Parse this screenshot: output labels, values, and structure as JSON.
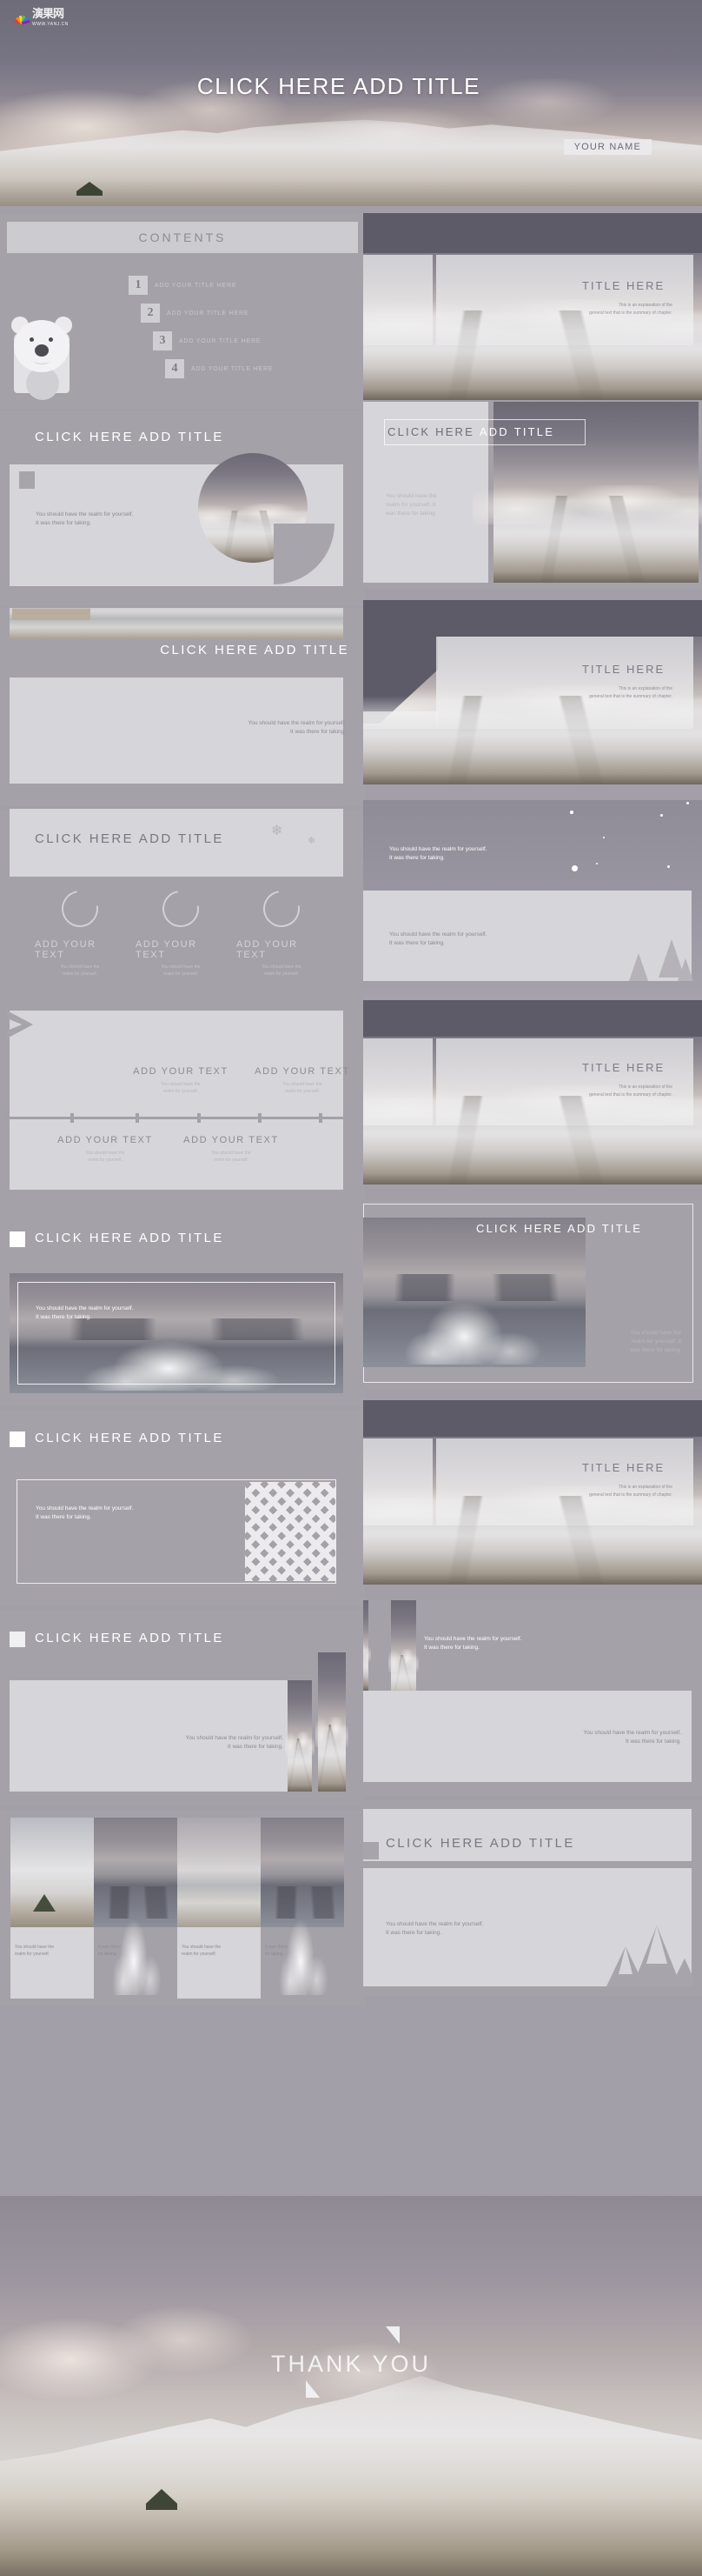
{
  "logo": {
    "name_zh": "演果网",
    "url": "WWW.YANJ.CN",
    "alt": "yanj-logo"
  },
  "cover": {
    "title": "CLICK HERE ADD TITLE",
    "name_box": "YOUR NAME"
  },
  "contents": {
    "heading": "CONTENTS",
    "items": [
      {
        "num": "1",
        "label": "ADD YOUR TITLE HERE"
      },
      {
        "num": "2",
        "label": "ADD YOUR TITLE HERE"
      },
      {
        "num": "3",
        "label": "ADD YOUR TITLE HERE"
      },
      {
        "num": "4",
        "label": "ADD YOUR TITLE HERE"
      }
    ]
  },
  "common": {
    "title": "CLICK HERE ADD TITLE",
    "chapter_title": "TITLE HERE",
    "chapter_sub_line1": "This is an explanation of the",
    "chapter_sub_line2": "general text that is the summary of chapter.",
    "body_line1": "You should have the realm for yourself.",
    "body_line2": "It was there for taking.",
    "body_short_1": "You should have the",
    "body_short_2": "realm for yourself. It",
    "body_short_3": "was there for taking.",
    "add_your_text": "ADD YOUR TEXT",
    "card_line1": "You should have the",
    "card_line2": "realm for yourself."
  },
  "slides": {
    "s03_circles": {
      "title": "CLICK HERE ADD TITLE",
      "cards": [
        {
          "heading": "ADD YOUR TEXT",
          "line1": "You should have the",
          "line2": "realm for yourself."
        },
        {
          "heading": "ADD YOUR TEXT",
          "line1": "You should have the",
          "line2": "realm for yourself."
        },
        {
          "heading": "ADD YOUR TEXT",
          "line1": "You should have the",
          "line2": "realm for yourself."
        }
      ]
    },
    "s04_timeline": {
      "top": [
        {
          "heading": "ADD YOUR TEXT",
          "line1": "You should have the",
          "line2": "realm for yourself."
        },
        {
          "heading": "ADD YOUR TEXT",
          "line1": "You should have the",
          "line2": "realm for yourself."
        }
      ],
      "bottom": [
        {
          "heading": "ADD YOUR TEXT",
          "line1": "You should have the",
          "line2": "realm for yourself."
        },
        {
          "heading": "ADD YOUR TEXT",
          "line1": "You should have the",
          "line2": "realm for yourself."
        }
      ]
    },
    "s12_gallery": {
      "captions": [
        {
          "line1": "You should have the",
          "line2": "realm for yourself."
        },
        {
          "line1": "It was there",
          "line2": "for taking."
        },
        {
          "line1": "You should have the",
          "line2": "realm for yourself."
        },
        {
          "line1": "It was there",
          "line2": "for taking."
        }
      ]
    }
  },
  "thanks": {
    "text": "THANK YOU"
  },
  "colors": {
    "page_bg": "#a39fa8",
    "panel_light": "#d6d5d9",
    "panel_mid": "#a5a1a9",
    "text_white": "#ffffff",
    "text_gray": "#8d8a94",
    "accent_dark": "#6f6c79"
  }
}
